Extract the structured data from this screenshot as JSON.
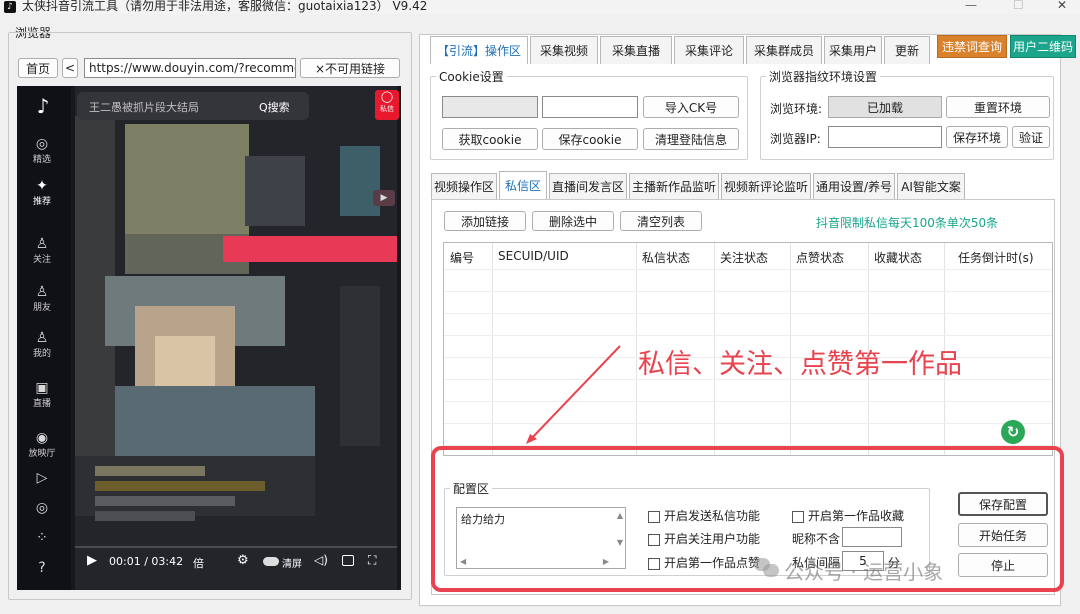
{
  "window": {
    "title": "太侠抖音引流工具（请勿用于非法用途，客服微信：guotaixia123）  V9.42",
    "controls": [
      "—",
      "☐",
      "✕"
    ]
  },
  "browser": {
    "group_label": "浏览器",
    "home_label": "首页",
    "back_label": "<",
    "url": "https://www.douyin.com/?recommend",
    "bad_link_label": "×不可用链接"
  },
  "player": {
    "search_text": "王二愚被抓片段大结局",
    "search_button": "Q搜索",
    "badge_label": "私信",
    "sidebar": [
      {
        "icon": "◎",
        "label": "精选"
      },
      {
        "icon": "✦",
        "label": "推荐"
      },
      {
        "icon": "♙",
        "label": "关注"
      },
      {
        "icon": "♙",
        "label": "朋友"
      },
      {
        "icon": "♙",
        "label": "我的"
      },
      {
        "icon": "▣",
        "label": "直播"
      },
      {
        "icon": "◉",
        "label": "放映厅"
      },
      {
        "icon": "▷",
        "label": ""
      },
      {
        "icon": "◎",
        "label": ""
      },
      {
        "icon": "⁘",
        "label": ""
      },
      {
        "icon": "?",
        "label": ""
      }
    ],
    "time": "00:01 / 03:42",
    "speed_label": "倍",
    "clear_label": "清屏"
  },
  "top_tabs": [
    {
      "label": "【引流】操作区",
      "active": true
    },
    {
      "label": "采集视频",
      "active": false
    },
    {
      "label": "采集直播",
      "active": false
    },
    {
      "label": "采集评论",
      "active": false
    },
    {
      "label": "采集群成员",
      "active": false
    },
    {
      "label": "采集用户",
      "active": false
    },
    {
      "label": "更新",
      "active": false
    }
  ],
  "header_buttons": {
    "banned_words": "违禁词查询",
    "qr": "用户二维码",
    "banned_color": "#d9822b",
    "qr_color": "#1aa58c"
  },
  "cookie": {
    "title": "Cookie设置",
    "import_ck": "导入CK号",
    "get_cookie": "获取cookie",
    "save_cookie": "保存cookie",
    "clear_login": "清理登陆信息"
  },
  "fingerprint": {
    "title": "浏览器指纹环境设置",
    "env_label": "浏览环境:",
    "env_status": "已加载",
    "reset_env": "重置环境",
    "ip_label": "浏览器IP:",
    "save_env": "保存环境",
    "verify": "验证"
  },
  "sub_tabs": [
    {
      "label": "视频操作区",
      "active": false
    },
    {
      "label": "私信区",
      "active": true
    },
    {
      "label": "直播间发言区",
      "active": false
    },
    {
      "label": "主播新作品监听",
      "active": false
    },
    {
      "label": "视频新评论监听",
      "active": false
    },
    {
      "label": "通用设置/养号",
      "active": false
    },
    {
      "label": "AI智能文案",
      "active": false
    }
  ],
  "dm": {
    "add_link": "添加链接",
    "delete_selected": "删除选中",
    "clear_list": "清空列表",
    "limit_notice": "抖音限制私信每天100条单次50条",
    "columns": [
      "编号",
      "SECUID/UID",
      "私信状态",
      "关注状态",
      "点赞状态",
      "收藏状态",
      "任务倒计时(s)"
    ],
    "rows": []
  },
  "annotation": {
    "text": "私信、关注、点赞第一作品",
    "color": "#e8434f"
  },
  "config": {
    "title": "配置区",
    "message": "给力给力",
    "opt_send_dm": "开启发送私信功能",
    "opt_follow": "开启关注用户功能",
    "opt_like_first": "开启第一作品点赞",
    "opt_fav_first": "开启第一作品收藏",
    "nickname_exclude_label": "昵称不含",
    "nickname_exclude_value": "",
    "interval_label": "私信间隔",
    "interval_value": "5",
    "interval_unit": "分",
    "save_config": "保存配置",
    "start_task": "开始任务",
    "stop": "停止"
  },
  "watermark": {
    "text": "公众号 · 运营小象"
  }
}
